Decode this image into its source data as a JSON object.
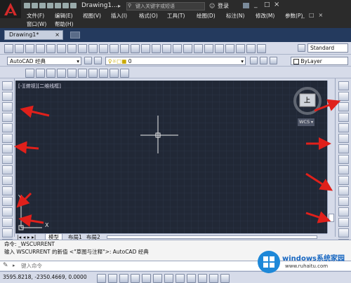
{
  "title": {
    "text": "Drawing1...."
  },
  "search": {
    "placeholder": "键入关键字或短语"
  },
  "login": "登录",
  "menu": {
    "row1": [
      "文件(F)",
      "编辑(E)",
      "视图(V)",
      "插入(I)",
      "格式(O)",
      "工具(T)",
      "绘图(D)",
      "标注(N)",
      "修改(M)",
      "参数(P)"
    ],
    "row2": [
      "窗口(W)",
      "帮助(H)"
    ]
  },
  "tabs": {
    "doc": "Drawing1*"
  },
  "toolbar": {
    "workspace": "AutoCAD 经典",
    "style": "Standard",
    "layer_value": "0",
    "bylayer": "ByLayer"
  },
  "viewport": {
    "label": "[-][俯视][二维线框]",
    "compass_top": "上",
    "wcs": "WCS",
    "ucs_y": "Y",
    "ucs_x": "X"
  },
  "layout_tabs": [
    "模型",
    "布局1",
    "布局2"
  ],
  "command": {
    "line1": "命令: _WSCURRENT",
    "line2": "输入 WSCURRENT 的新值 <\"草图与注释\">: AutoCAD 经典",
    "input_placeholder": "键入命令"
  },
  "status": {
    "coords": "3595.8218, -2350.4669, 0.0000"
  },
  "watermark": {
    "brand": "windows系统家园",
    "url": "www.ruhaitu.com"
  },
  "colors": {
    "arrow": "#e0201b",
    "canvas": "#212836",
    "titlebar": "#2b2b2b"
  }
}
